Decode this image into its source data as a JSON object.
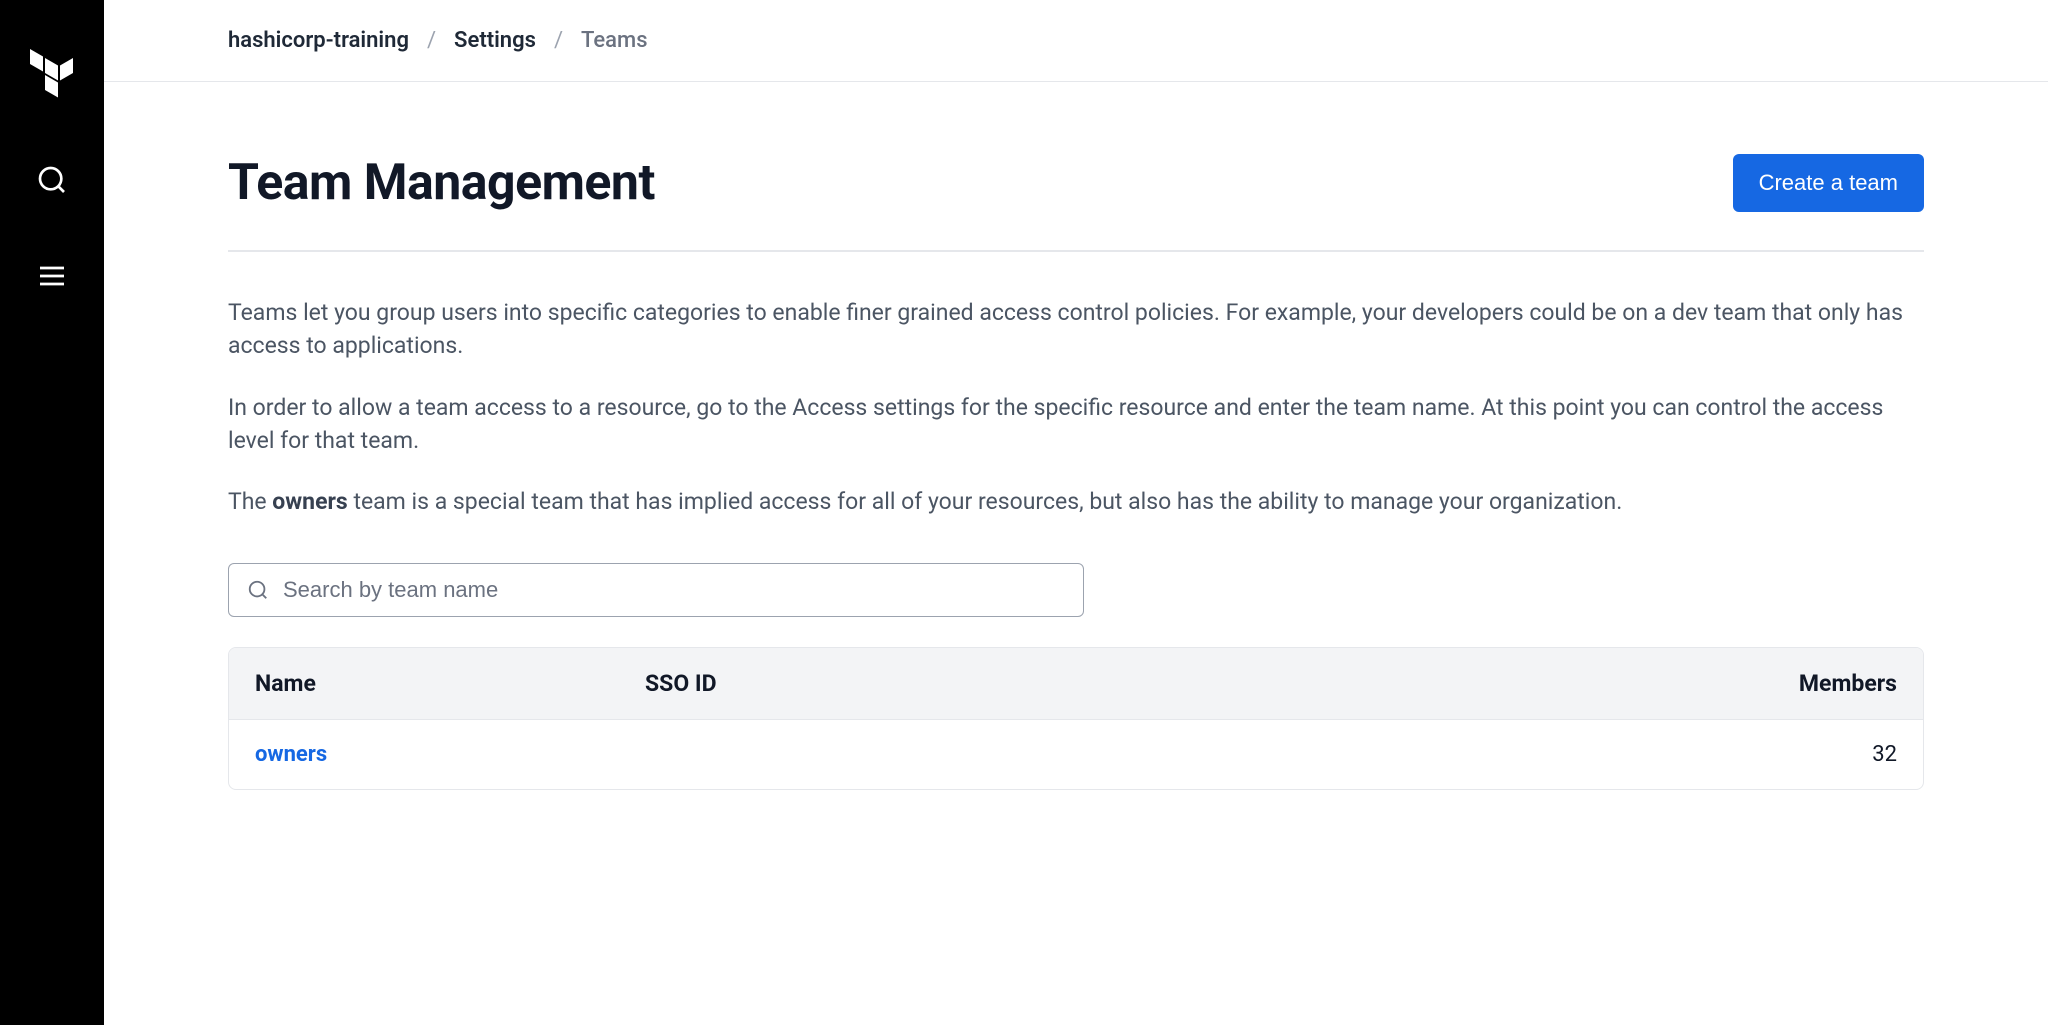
{
  "breadcrumb": {
    "org": "hashicorp-training",
    "settings": "Settings",
    "current": "Teams"
  },
  "page": {
    "title": "Team Management",
    "create_button": "Create a team"
  },
  "desc": {
    "p1": "Teams let you group users into specific categories to enable finer grained access control policies. For example, your developers could be on a dev team that only has access to applications.",
    "p2": "In order to allow a team access to a resource, go to the Access settings for the specific resource and enter the team name. At this point you can control the access level for that team.",
    "p3a": "The ",
    "p3_strong": "owners",
    "p3b": " team is a special team that has implied access for all of your resources, but also has the ability to manage your organization."
  },
  "search": {
    "placeholder": "Search by team name"
  },
  "table": {
    "headers": {
      "name": "Name",
      "sso": "SSO ID",
      "members": "Members"
    },
    "rows": [
      {
        "name": "owners",
        "sso": "",
        "members": "32"
      }
    ]
  }
}
